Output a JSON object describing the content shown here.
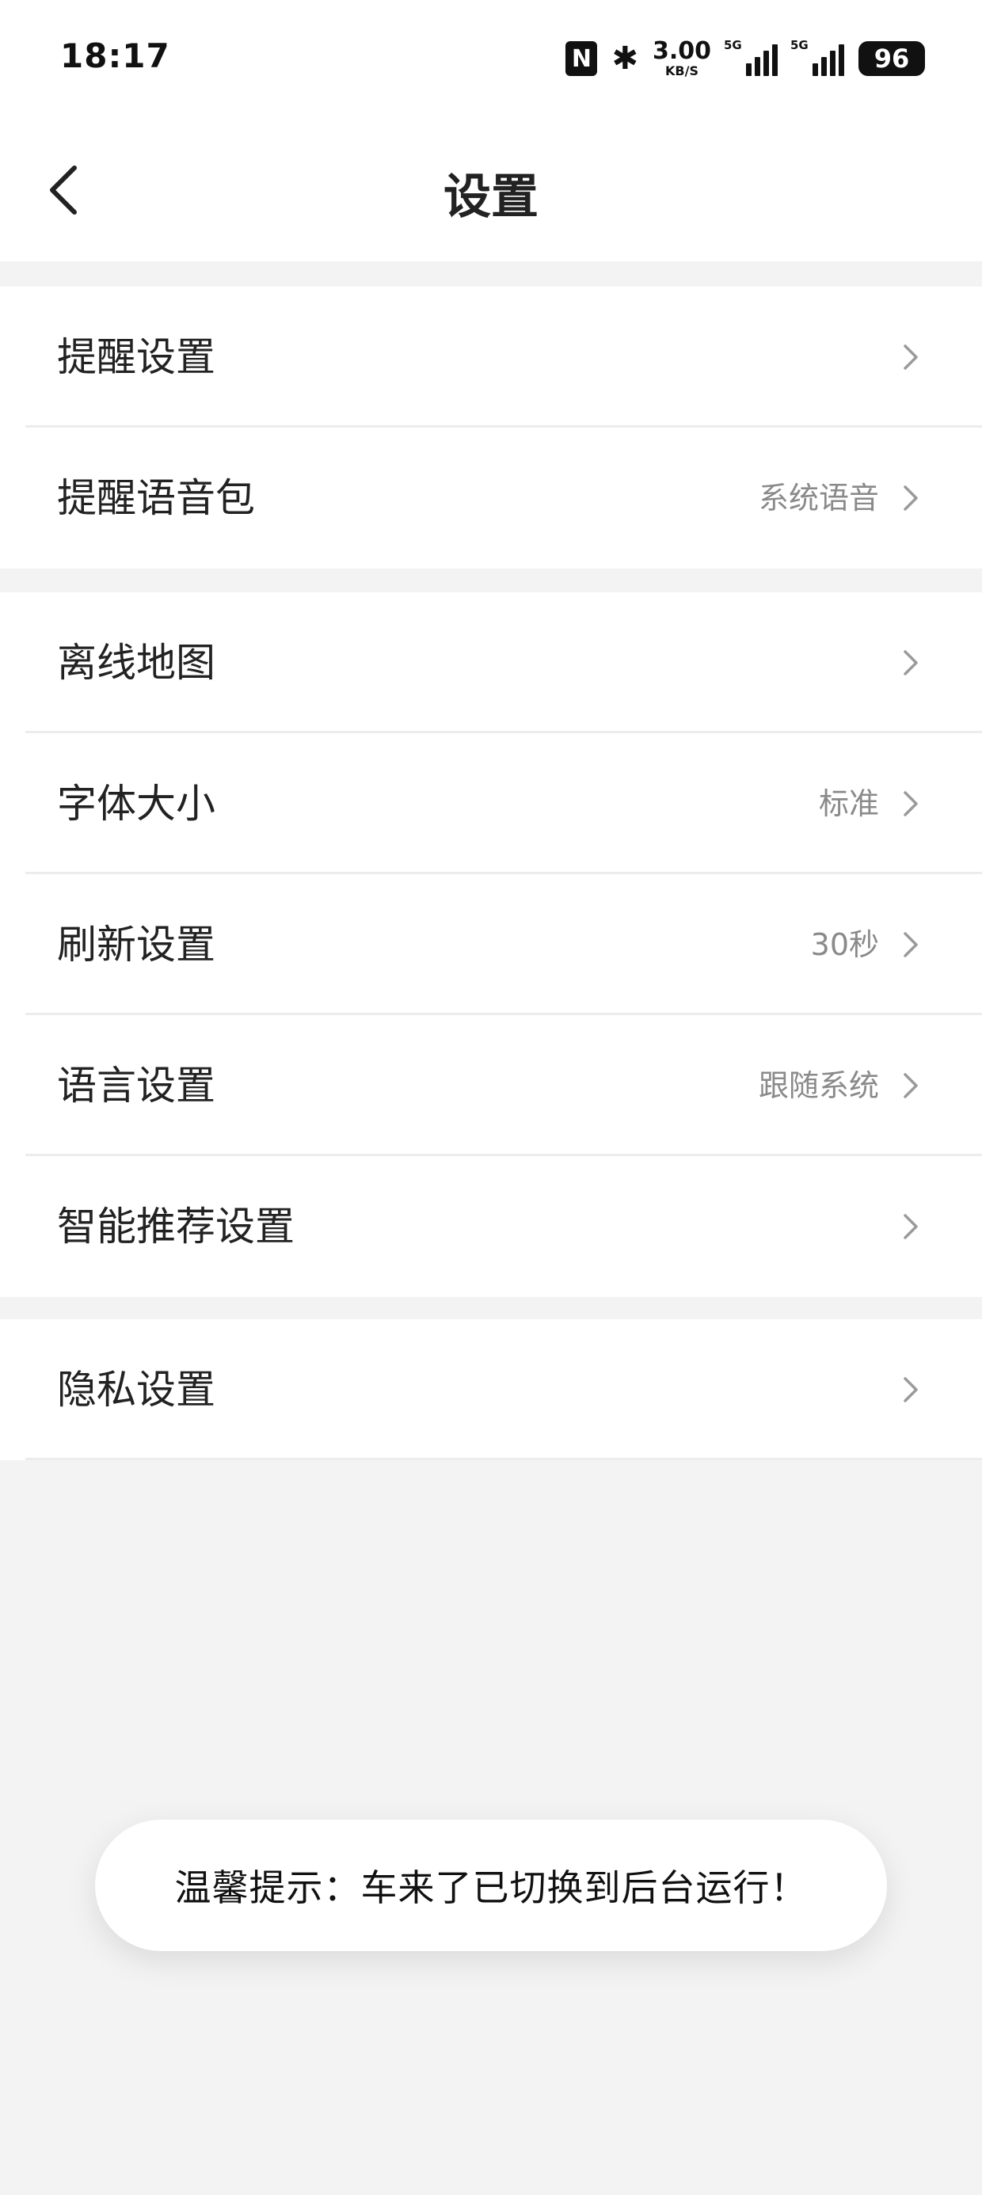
{
  "status_bar": {
    "time": "18:17",
    "nfc": "N",
    "bluetooth": "✱",
    "speed_value": "3.00",
    "speed_unit": "KB/S",
    "signal_1_label": "5G",
    "signal_2_label": "5G",
    "battery": "96"
  },
  "header": {
    "title": "设置",
    "back_icon": "chevron-left-icon"
  },
  "groups": [
    {
      "items": [
        {
          "label": "提醒设置",
          "value": ""
        },
        {
          "label": "提醒语音包",
          "value": "系统语音"
        }
      ]
    },
    {
      "items": [
        {
          "label": "离线地图",
          "value": ""
        },
        {
          "label": "字体大小",
          "value": "标准"
        },
        {
          "label": "刷新设置",
          "value": "30秒"
        },
        {
          "label": "语言设置",
          "value": "跟随系统"
        },
        {
          "label": "智能推荐设置",
          "value": ""
        }
      ]
    },
    {
      "items": [
        {
          "label": "隐私设置",
          "value": ""
        }
      ]
    }
  ],
  "toast": {
    "text": "温馨提示：车来了已切换到后台运行！"
  },
  "colors": {
    "background": "#f3f3f3",
    "surface": "#ffffff",
    "secondary_text": "#8a8a8a",
    "chevron": "#9a9a9a"
  }
}
